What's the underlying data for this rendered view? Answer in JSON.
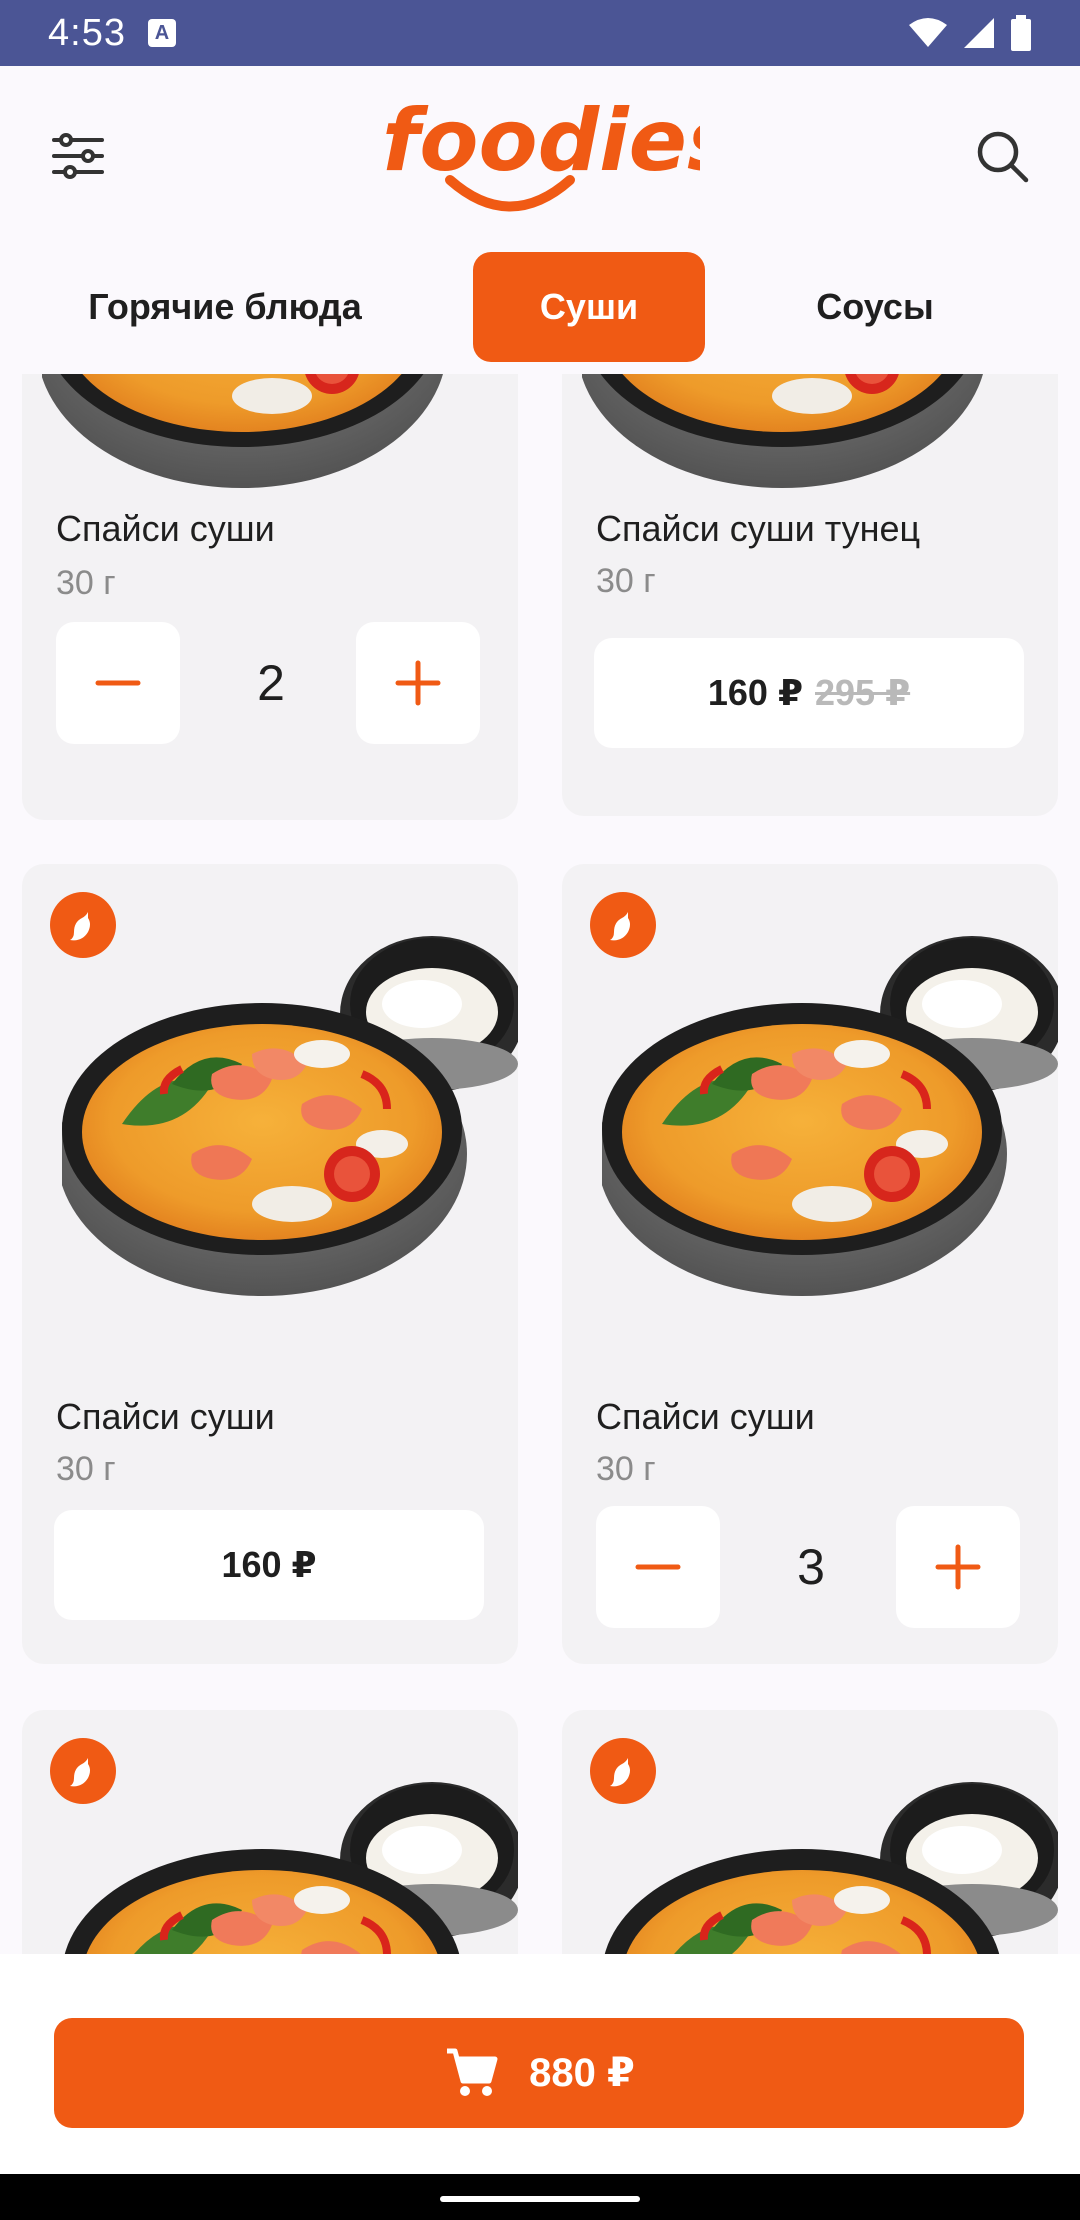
{
  "status_bar": {
    "time": "4:53",
    "notification_icon": "a-icon"
  },
  "header": {
    "logo_text": "foodies",
    "filter_icon": "filter-icon",
    "search_icon": "search-icon"
  },
  "tabs": [
    {
      "label": "Горячие блюда",
      "active": false
    },
    {
      "label": "Суши",
      "active": true
    },
    {
      "label": "Соусы",
      "active": false
    }
  ],
  "products": [
    {
      "name": "Спайси суши",
      "weight": "30 г",
      "quantity": "2",
      "minus_icon": "minus-icon",
      "plus_icon": "plus-icon"
    },
    {
      "name": "Спайси суши тунец",
      "weight": "30 г",
      "price": "160 ₽",
      "old_price": "295 ₽"
    },
    {
      "name": "Спайси суши",
      "weight": "30 г",
      "price": "160 ₽",
      "badge_icon": "chili-pepper-icon"
    },
    {
      "name": "Спайси суши",
      "weight": "30 г",
      "quantity": "3",
      "badge_icon": "chili-pepper-icon"
    }
  ],
  "cart": {
    "icon": "cart-icon",
    "total": "880 ₽"
  },
  "colors": {
    "accent": "#f05a14",
    "status_bar": "#4b5595",
    "card": "#f3f2f4"
  }
}
